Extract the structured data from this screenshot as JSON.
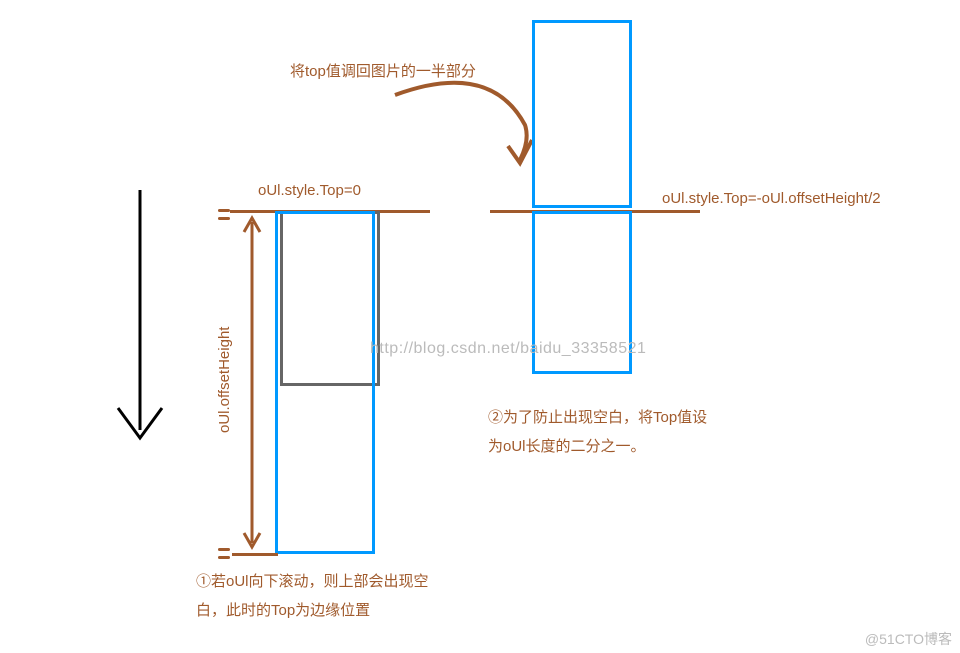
{
  "labels": {
    "top_annotation": "将top值调回图片的一半部分",
    "left_label": "oUl.style.Top=0",
    "right_label": "oUl.style.Top=-oUl.offsetHeight/2",
    "offset_label": "oUl.offsetHeight",
    "caption_left_line1": "①若oUl向下滚动，则上部会出现空",
    "caption_left_line2": "白，此时的Top为边缘位置",
    "caption_right_line1": "②为了防止出现空白，将Top值设",
    "caption_right_line2": "为oUl长度的二分之一。"
  },
  "watermark": "http://blog.csdn.net/baidu_33358521",
  "credit": "@51CTO博客",
  "colors": {
    "brown": "#a05a2c",
    "blue": "#0099ff",
    "gray": "#666"
  }
}
